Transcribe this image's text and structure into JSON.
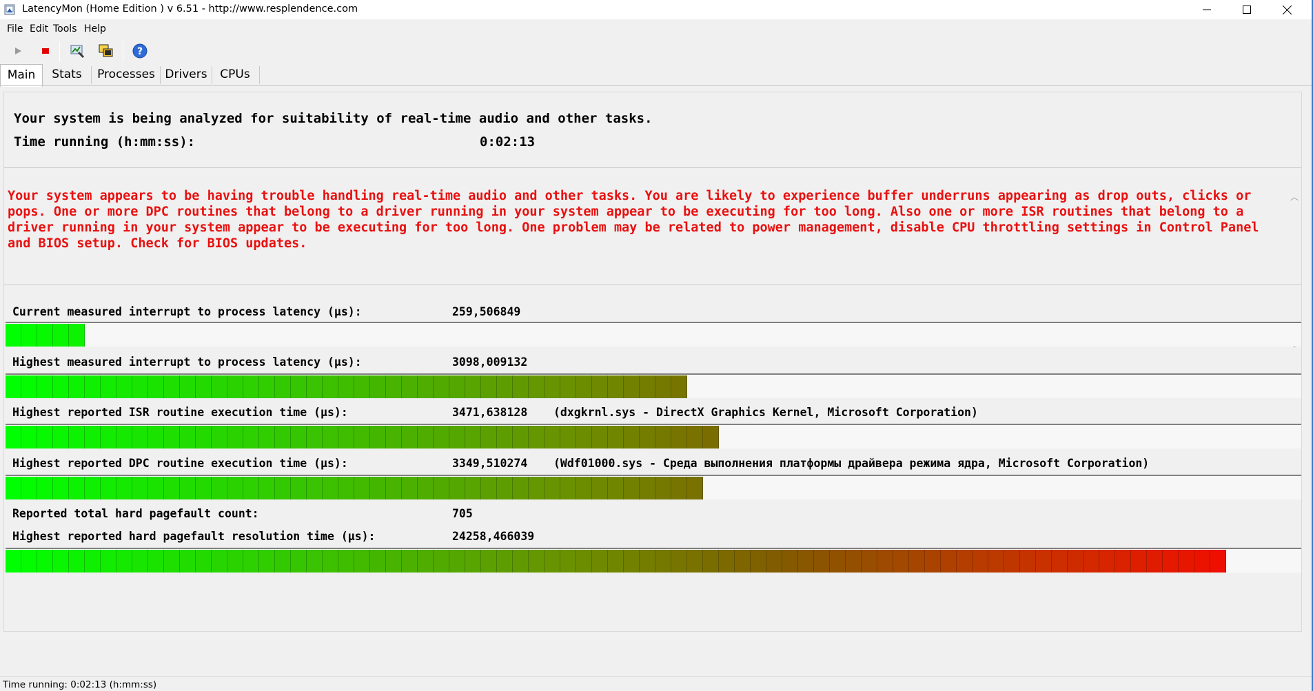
{
  "window": {
    "title": "LatencyMon  (Home Edition )  v 6.51 - http://www.resplendence.com"
  },
  "menu": [
    "File",
    "Edit",
    "Tools",
    "Help"
  ],
  "toolbar": {
    "icons": [
      "play-icon",
      "stop-icon",
      "analyze-icon",
      "windows-icon",
      "help-icon"
    ]
  },
  "tabs": [
    "Main",
    "Stats",
    "Processes",
    "Drivers",
    "CPUs"
  ],
  "main": {
    "analysis_text": "Your system is being analyzed for suitability of real-time audio and other tasks.",
    "time_label": "Time running (h:mm:ss):",
    "time_value": "0:02:13",
    "warning": "Your system appears to be having trouble handling real-time audio and other tasks. You are likely to experience buffer underruns appearing as drop outs, clicks or pops. One or more DPC routines that belong to a driver running in your system appear to be executing for too long. Also one or more ISR routines that belong to a driver running in your system appear to be executing for too long. One problem may be related to power management, disable CPU throttling settings in Control Panel and BIOS setup. Check for BIOS updates.",
    "metrics": [
      {
        "label": "Current measured interrupt to process latency (µs):",
        "value": "259,506849",
        "extra": "",
        "bar_fraction": 0.057
      },
      {
        "label": "Highest measured interrupt to process latency (µs):",
        "value": "3098,009132",
        "extra": "",
        "bar_fraction": 0.525
      },
      {
        "label": "Highest reported ISR routine execution time (µs):",
        "value": "3471,638128",
        "extra": "(dxgkrnl.sys - DirectX Graphics Kernel, Microsoft Corporation)",
        "bar_fraction": 0.55
      },
      {
        "label": "Highest reported DPC routine execution time (µs):",
        "value": "3349,510274",
        "extra": "(Wdf01000.sys - Среда выполнения платформы драйвера режима ядра, Microsoft Corporation)",
        "bar_fraction": 0.545
      },
      {
        "label": "Reported total hard pagefault count:",
        "value": "705",
        "extra": "",
        "bar_fraction": null
      },
      {
        "label": "Highest reported hard pagefault resolution time (µs):",
        "value": "24258,466039",
        "extra": "",
        "bar_fraction": 0.955
      }
    ]
  },
  "statusbar": {
    "text": "Time running: 0:02:13  (h:mm:ss)"
  },
  "colors": {
    "warning": "#e8100f",
    "bar_start": "#00ff00",
    "bar_end": "#ff0000"
  }
}
